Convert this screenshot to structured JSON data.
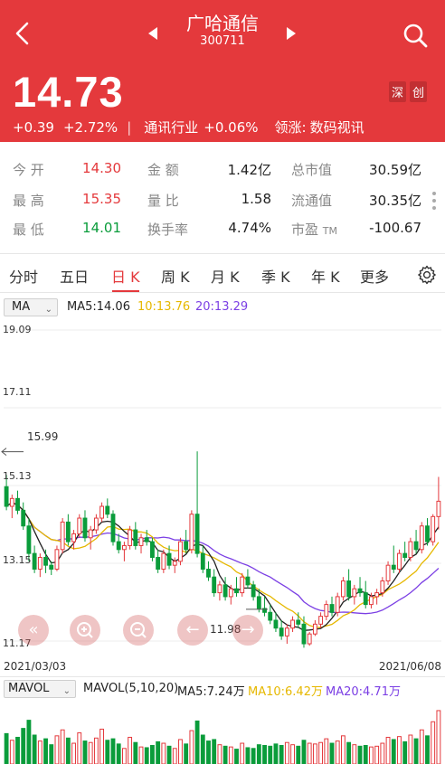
{
  "header": {
    "title": "广哈通信",
    "code": "300711",
    "price": "14.73",
    "change": "+0.39",
    "change_pct": "+2.72%",
    "industry": "通讯行业",
    "industry_change": "+0.06%",
    "leader_label": "领涨:",
    "leader": "数码视讯",
    "tags": [
      "深",
      "创"
    ]
  },
  "stats": {
    "open_label": "今 开",
    "open": "14.30",
    "high_label": "最 高",
    "high": "15.35",
    "low_label": "最 低",
    "low": "14.01",
    "amount_label": "金 额",
    "amount": "1.42亿",
    "ratio_label": "量 比",
    "ratio": "1.58",
    "turnover_label": "换手率",
    "turnover": "4.74%",
    "mktcap_label": "总市值",
    "mktcap": "30.59亿",
    "float_label": "流通值",
    "float": "30.35亿",
    "pe_label": "市盈",
    "pe_sub": "TM",
    "pe": "-100.67"
  },
  "tabs": [
    "分时",
    "五日",
    "日 K",
    "周 K",
    "月 K",
    "季 K",
    "年 K",
    "更多"
  ],
  "active_tab": "日 K",
  "ma": {
    "selector": "MA",
    "ma5": "MA5:14.06",
    "ma10": "10:13.76",
    "ma20": "20:13.29"
  },
  "chart_labels": {
    "y_top": "19.09",
    "y2": "17.11",
    "y3": "15.13",
    "y4": "13.15",
    "y_bottom": "11.17",
    "high_mark": "15.99",
    "low_mark": "11.98",
    "date_start": "2021/03/03",
    "date_end": "2021/06/08"
  },
  "vol": {
    "selector": "MAVOL",
    "mavol": "MAVOL(5,10,20)",
    "ma5": "MA5:7.24万",
    "ma10": "MA10:6.42万",
    "ma20": "MA20:4.71万"
  },
  "colors": {
    "up": "#e4393c",
    "down": "#0a9c3b",
    "ma5": "#222222",
    "ma10": "#e6b800",
    "ma20": "#7b3fe4"
  },
  "chart_data": {
    "type": "candlestick",
    "x_range": [
      "2021/03/03",
      "2021/06/08"
    ],
    "ylim": [
      11.17,
      19.09
    ],
    "y_ticks": [
      19.09,
      17.11,
      15.13,
      13.15,
      11.17
    ],
    "period_high": 15.99,
    "period_low": 11.98,
    "candles": [
      [
        15.1,
        15.4,
        14.5,
        14.6
      ],
      [
        14.6,
        14.9,
        14.3,
        14.8
      ],
      [
        14.8,
        15.0,
        14.4,
        14.5
      ],
      [
        14.5,
        14.7,
        14.0,
        14.1
      ],
      [
        14.1,
        14.3,
        13.2,
        13.4
      ],
      [
        13.4,
        13.6,
        12.9,
        13.0
      ],
      [
        13.0,
        13.4,
        12.8,
        13.3
      ],
      [
        13.3,
        13.5,
        12.9,
        13.1
      ],
      [
        13.1,
        13.2,
        12.85,
        13.0
      ],
      [
        13.0,
        13.6,
        12.95,
        13.5
      ],
      [
        13.5,
        14.3,
        13.4,
        14.2
      ],
      [
        14.2,
        14.4,
        13.6,
        13.7
      ],
      [
        13.7,
        14.0,
        13.5,
        13.9
      ],
      [
        13.9,
        14.4,
        13.8,
        14.3
      ],
      [
        14.3,
        14.5,
        13.7,
        13.8
      ],
      [
        13.8,
        14.1,
        13.5,
        14.0
      ],
      [
        14.0,
        14.4,
        13.9,
        14.3
      ],
      [
        14.3,
        14.7,
        14.2,
        14.6
      ],
      [
        14.6,
        14.8,
        14.3,
        14.4
      ],
      [
        14.4,
        14.5,
        13.6,
        13.7
      ],
      [
        13.7,
        13.9,
        13.4,
        13.5
      ],
      [
        13.5,
        13.7,
        13.2,
        13.6
      ],
      [
        13.6,
        14.1,
        13.5,
        14.0
      ],
      [
        14.0,
        14.2,
        13.5,
        13.6
      ],
      [
        13.6,
        13.9,
        13.4,
        13.8
      ],
      [
        13.8,
        14.0,
        13.6,
        13.7
      ],
      [
        13.7,
        13.8,
        13.2,
        13.3
      ],
      [
        13.3,
        13.5,
        12.9,
        13.0
      ],
      [
        13.0,
        13.5,
        12.9,
        13.4
      ],
      [
        13.4,
        13.6,
        13.0,
        13.1
      ],
      [
        13.1,
        13.3,
        12.9,
        13.2
      ],
      [
        13.2,
        13.8,
        13.1,
        13.7
      ],
      [
        13.7,
        14.0,
        13.4,
        13.5
      ],
      [
        13.5,
        14.5,
        13.4,
        14.4
      ],
      [
        14.4,
        16.0,
        13.3,
        13.4
      ],
      [
        13.4,
        13.6,
        12.9,
        13.0
      ],
      [
        13.0,
        13.2,
        12.7,
        12.8
      ],
      [
        12.8,
        13.0,
        12.3,
        12.4
      ],
      [
        12.4,
        12.7,
        12.2,
        12.6
      ],
      [
        12.6,
        12.8,
        12.2,
        12.3
      ],
      [
        12.3,
        12.6,
        12.1,
        12.5
      ],
      [
        12.5,
        12.8,
        12.3,
        12.4
      ],
      [
        12.4,
        12.9,
        12.3,
        12.8
      ],
      [
        12.8,
        13.0,
        12.5,
        12.6
      ],
      [
        12.6,
        12.7,
        12.2,
        12.3
      ],
      [
        12.3,
        12.5,
        11.9,
        12.0
      ],
      [
        12.0,
        12.3,
        11.8,
        11.9
      ],
      [
        11.9,
        12.1,
        11.6,
        11.7
      ],
      [
        11.7,
        11.9,
        11.4,
        11.5
      ],
      [
        11.5,
        11.7,
        11.2,
        11.3
      ],
      [
        11.3,
        11.6,
        11.1,
        11.5
      ],
      [
        11.5,
        11.8,
        11.4,
        11.7
      ],
      [
        11.7,
        11.9,
        11.5,
        11.6
      ],
      [
        11.6,
        11.8,
        11.0,
        11.1
      ],
      [
        11.1,
        11.4,
        11.05,
        11.35
      ],
      [
        11.35,
        11.7,
        11.3,
        11.6
      ],
      [
        11.6,
        11.9,
        11.5,
        11.8
      ],
      [
        11.8,
        12.2,
        11.7,
        12.1
      ],
      [
        12.1,
        12.3,
        11.8,
        11.9
      ],
      [
        11.9,
        12.4,
        11.8,
        12.3
      ],
      [
        12.3,
        12.8,
        12.2,
        12.7
      ],
      [
        12.7,
        13.0,
        12.2,
        12.3
      ],
      [
        12.3,
        12.6,
        12.1,
        12.5
      ],
      [
        12.5,
        12.8,
        12.3,
        12.4
      ],
      [
        12.4,
        12.7,
        12.0,
        12.1
      ],
      [
        12.1,
        12.4,
        12.0,
        12.3
      ],
      [
        12.3,
        12.5,
        12.1,
        12.4
      ],
      [
        12.4,
        12.8,
        12.3,
        12.7
      ],
      [
        12.7,
        13.2,
        12.6,
        13.1
      ],
      [
        13.1,
        13.6,
        12.9,
        13.0
      ],
      [
        13.0,
        13.5,
        12.9,
        13.4
      ],
      [
        13.4,
        13.7,
        13.2,
        13.3
      ],
      [
        13.3,
        13.8,
        13.2,
        13.7
      ],
      [
        13.7,
        14.0,
        13.4,
        13.5
      ],
      [
        13.5,
        14.2,
        13.4,
        14.1
      ],
      [
        14.1,
        14.3,
        13.6,
        13.7
      ],
      [
        13.7,
        14.4,
        13.6,
        14.34
      ],
      [
        14.34,
        15.35,
        14.01,
        14.73
      ]
    ],
    "volume": [
      4.1,
      3.2,
      3.6,
      4.8,
      5.9,
      3.9,
      3.1,
      3.4,
      2.6,
      3.8,
      4.6,
      3.5,
      2.8,
      4.2,
      3.1,
      2.9,
      3.5,
      4.7,
      3.2,
      3.4,
      2.7,
      2.1,
      3.6,
      2.9,
      2.3,
      2.2,
      2.5,
      3.0,
      2.8,
      2.4,
      2.1,
      3.3,
      2.7,
      4.5,
      5.8,
      3.9,
      3.1,
      3.3,
      2.6,
      2.4,
      2.3,
      2.0,
      2.8,
      2.2,
      2.1,
      2.6,
      2.5,
      2.4,
      2.7,
      2.5,
      2.9,
      2.6,
      2.4,
      3.2,
      2.8,
      2.7,
      2.9,
      3.4,
      2.8,
      3.1,
      3.8,
      2.9,
      2.6,
      2.4,
      2.5,
      2.3,
      2.4,
      2.8,
      3.6,
      3.3,
      3.7,
      3.0,
      3.9,
      3.4,
      4.6,
      3.8,
      5.7,
      7.2
    ]
  }
}
